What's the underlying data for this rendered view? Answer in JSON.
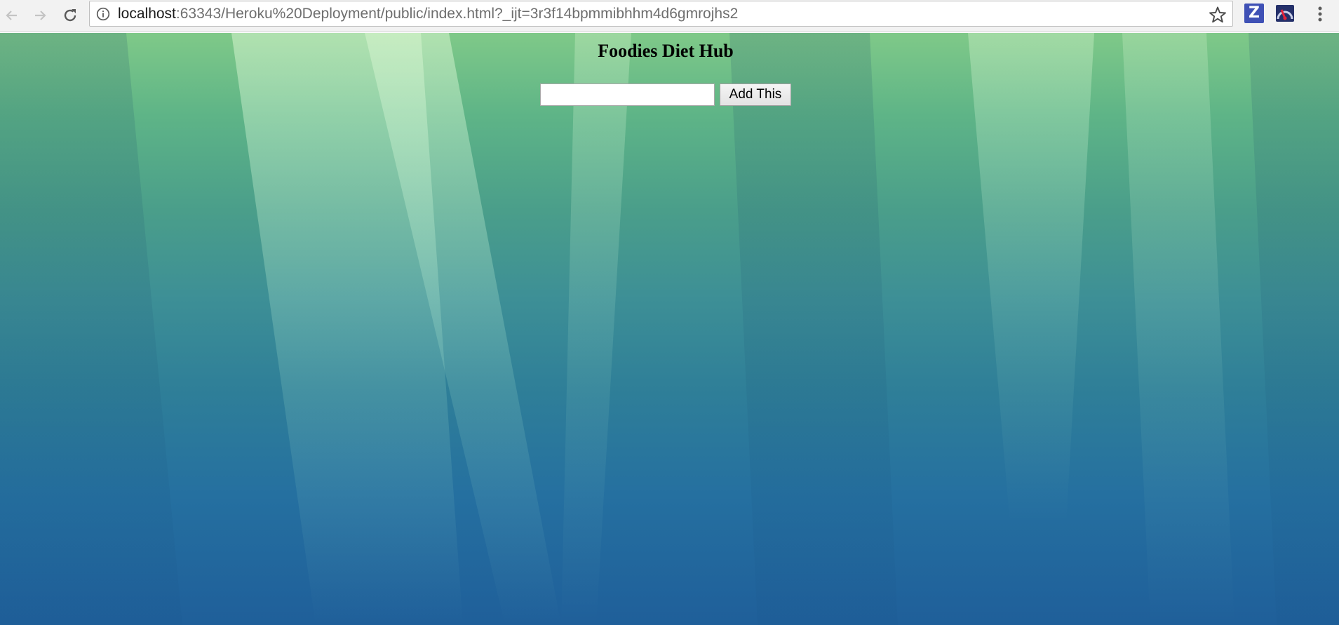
{
  "browser": {
    "url_host": "localhost",
    "url_rest": ":63343/Heroku%20Deployment/public/index.html?_ijt=3r3f14bpmmibhhm4d6gmrojhs2",
    "icons": {
      "back": "arrow-left-icon",
      "forward": "arrow-right-icon",
      "reload": "reload-icon",
      "info": "info-icon",
      "bookmark": "star-icon",
      "extension_1": "z-extension-icon",
      "extension_2": "gauge-extension-icon",
      "menu": "vertical-dots-menu-icon"
    },
    "extension_1_label": "Z"
  },
  "page": {
    "title": "Foodies Diet Hub",
    "input_value": "",
    "add_button_label": "Add This"
  },
  "colors": {
    "background_top": "#7fc988",
    "background_bottom": "#1f5f9a",
    "extension_z": "#3f51b5"
  }
}
